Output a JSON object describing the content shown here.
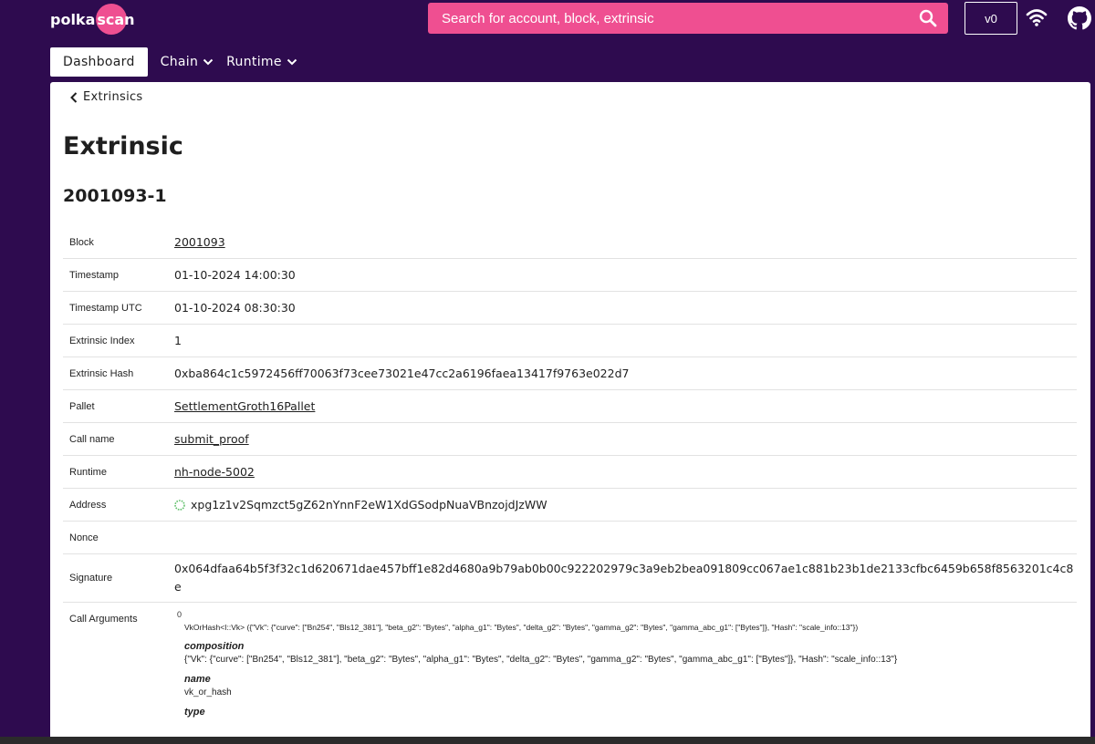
{
  "header": {
    "logo_prefix": "polka",
    "logo_suffix": "scan",
    "search_placeholder": "Search for account, block, extrinsic",
    "version": "v0"
  },
  "nav": {
    "tabs": [
      {
        "label": "Dashboard",
        "active": true
      },
      {
        "label": "Chain",
        "active": false
      },
      {
        "label": "Runtime",
        "active": false
      }
    ]
  },
  "page": {
    "back_label": "Extrinsics",
    "title": "Extrinsic",
    "extrinsic_id": "2001093-1"
  },
  "details": {
    "block_label": "Block",
    "block": "2001093",
    "timestamp_label": "Timestamp",
    "timestamp": "01-10-2024 14:00:30",
    "timestamp_utc_label": "Timestamp UTC",
    "timestamp_utc": "01-10-2024 08:30:30",
    "extrinsic_index_label": "Extrinsic Index",
    "extrinsic_index": "1",
    "extrinsic_hash_label": "Extrinsic Hash",
    "extrinsic_hash": "0xba864c1c5972456ff70063f73cee73021e47cc2a6196faea13417f9763e022d7",
    "pallet_label": "Pallet",
    "pallet": "SettlementGroth16Pallet",
    "call_name_label": "Call name",
    "call_name": "submit_proof",
    "runtime_label": "Runtime",
    "runtime": "nh-node-5002",
    "address_label": "Address",
    "address": "xpg1z1v2Sqmzct5gZ62nYnnF2eW1XdGSodpNuaVBnzojdJzWW",
    "nonce_label": "Nonce",
    "nonce": "",
    "signature_label": "Signature",
    "signature": "0x064dfaa64b5f3f32c1d620671dae457bff1e82d4680a9b79ab0b00c922202979c3a9eb2bea091809cc067ae1c881b23b1de2133cfbc6459b658f8563201c4c8e",
    "call_arguments_label": "Call Arguments"
  },
  "call_arguments": {
    "index": "0",
    "type_line": "VkOrHash<I::Vk> ({\"Vk\": {\"curve\": [\"Bn254\", \"Bls12_381\"], \"beta_g2\": \"Bytes\", \"alpha_g1\": \"Bytes\", \"delta_g2\": \"Bytes\", \"gamma_g2\": \"Bytes\", \"gamma_abc_g1\": [\"Bytes\"]}, \"Hash\": \"scale_info::13\"})",
    "composition_label": "composition",
    "composition": "{\"Vk\": {\"curve\": [\"Bn254\", \"Bls12_381\"], \"beta_g2\": \"Bytes\", \"alpha_g1\": \"Bytes\", \"delta_g2\": \"Bytes\", \"gamma_g2\": \"Bytes\", \"gamma_abc_g1\": [\"Bytes\"]}, \"Hash\": \"scale_info::13\"}",
    "name_label": "name",
    "name": "vk_or_hash",
    "type_label": "type"
  },
  "colors": {
    "background": "#2e0b4f",
    "accent": "#ef4f91",
    "card": "#ffffff"
  },
  "icons": [
    "search-icon",
    "wifi-icon",
    "github-icon",
    "chevron-down-icon",
    "chevron-left-icon",
    "identicon-icon"
  ]
}
